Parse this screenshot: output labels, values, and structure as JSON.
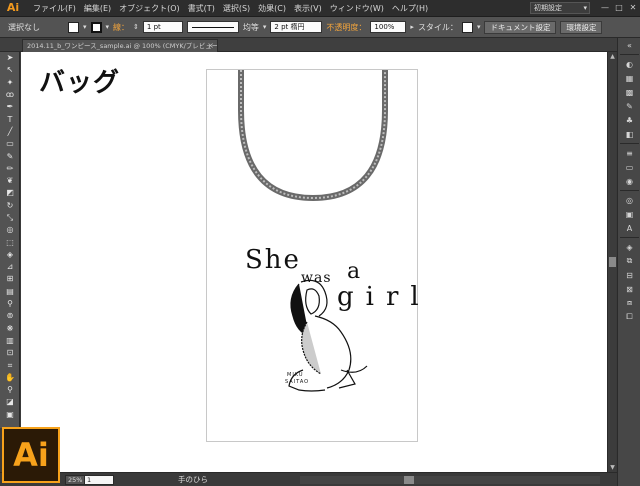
{
  "app": {
    "logo_text": "Ai"
  },
  "menubar": {
    "items": [
      "ファイル(F)",
      "編集(E)",
      "オブジェクト(O)",
      "書式(T)",
      "選択(S)",
      "効果(C)",
      "表示(V)",
      "ウィンドウ(W)",
      "ヘルプ(H)"
    ],
    "workspace": "初期設定",
    "window_buttons": [
      "—",
      "□",
      "✕"
    ]
  },
  "controlbar": {
    "selection_label": "選択なし",
    "stroke_label": "線：",
    "stroke_weight": "1 pt",
    "stroke_style": "均等",
    "brush": "2 pt 楕円",
    "opacity_label": "不透明度：",
    "opacity_value": "100%",
    "style_label": "スタイル：",
    "doc_settings_button": "ドキュメント設定",
    "preferences_button": "環境設定"
  },
  "document": {
    "tab_title": "2014.11_b_ワンピース_sample.ai @ 100% (CMYK/プレビュー)"
  },
  "canvas": {
    "page_title": "バッグ",
    "artwork_text": [
      "She",
      "was",
      "a",
      "girl"
    ],
    "artist_caption_1": "MIKU",
    "artist_caption_2": "SAITAO"
  },
  "status": {
    "zoom": "25%",
    "page": "1",
    "tool_text": "手のひら"
  },
  "colors": {
    "accent": "#f7a21b",
    "panel_bg": "#535353",
    "canvas_bg": "#ffffff"
  },
  "icons": {
    "toolbar": [
      "selection-icon",
      "direct-selection-icon",
      "magic-wand-icon",
      "lasso-icon",
      "pen-icon",
      "type-icon",
      "line-icon",
      "rectangle-icon",
      "paintbrush-icon",
      "pencil-icon",
      "blob-brush-icon",
      "eraser-icon",
      "rotate-icon",
      "scale-icon",
      "warp-icon",
      "free-transform-icon",
      "shape-builder-icon",
      "perspective-icon",
      "mesh-icon",
      "gradient-icon",
      "eyedropper-icon",
      "blend-icon",
      "symbol-sprayer-icon",
      "graph-icon",
      "artboard-icon",
      "slice-icon",
      "hand-icon",
      "zoom-icon",
      "fill-stroke-icon",
      "screen-mode-icon"
    ],
    "dock": [
      "color-icon",
      "color-guide-icon",
      "swatches-icon",
      "brushes-icon",
      "symbols-icon",
      "graphic-styles-icon",
      "stroke-icon",
      "gradient-panel-icon",
      "transparency-icon",
      "appearance-icon",
      "layers-icon",
      "artboards-icon",
      "align-icon",
      "transform-icon",
      "pathfinder-icon"
    ]
  }
}
